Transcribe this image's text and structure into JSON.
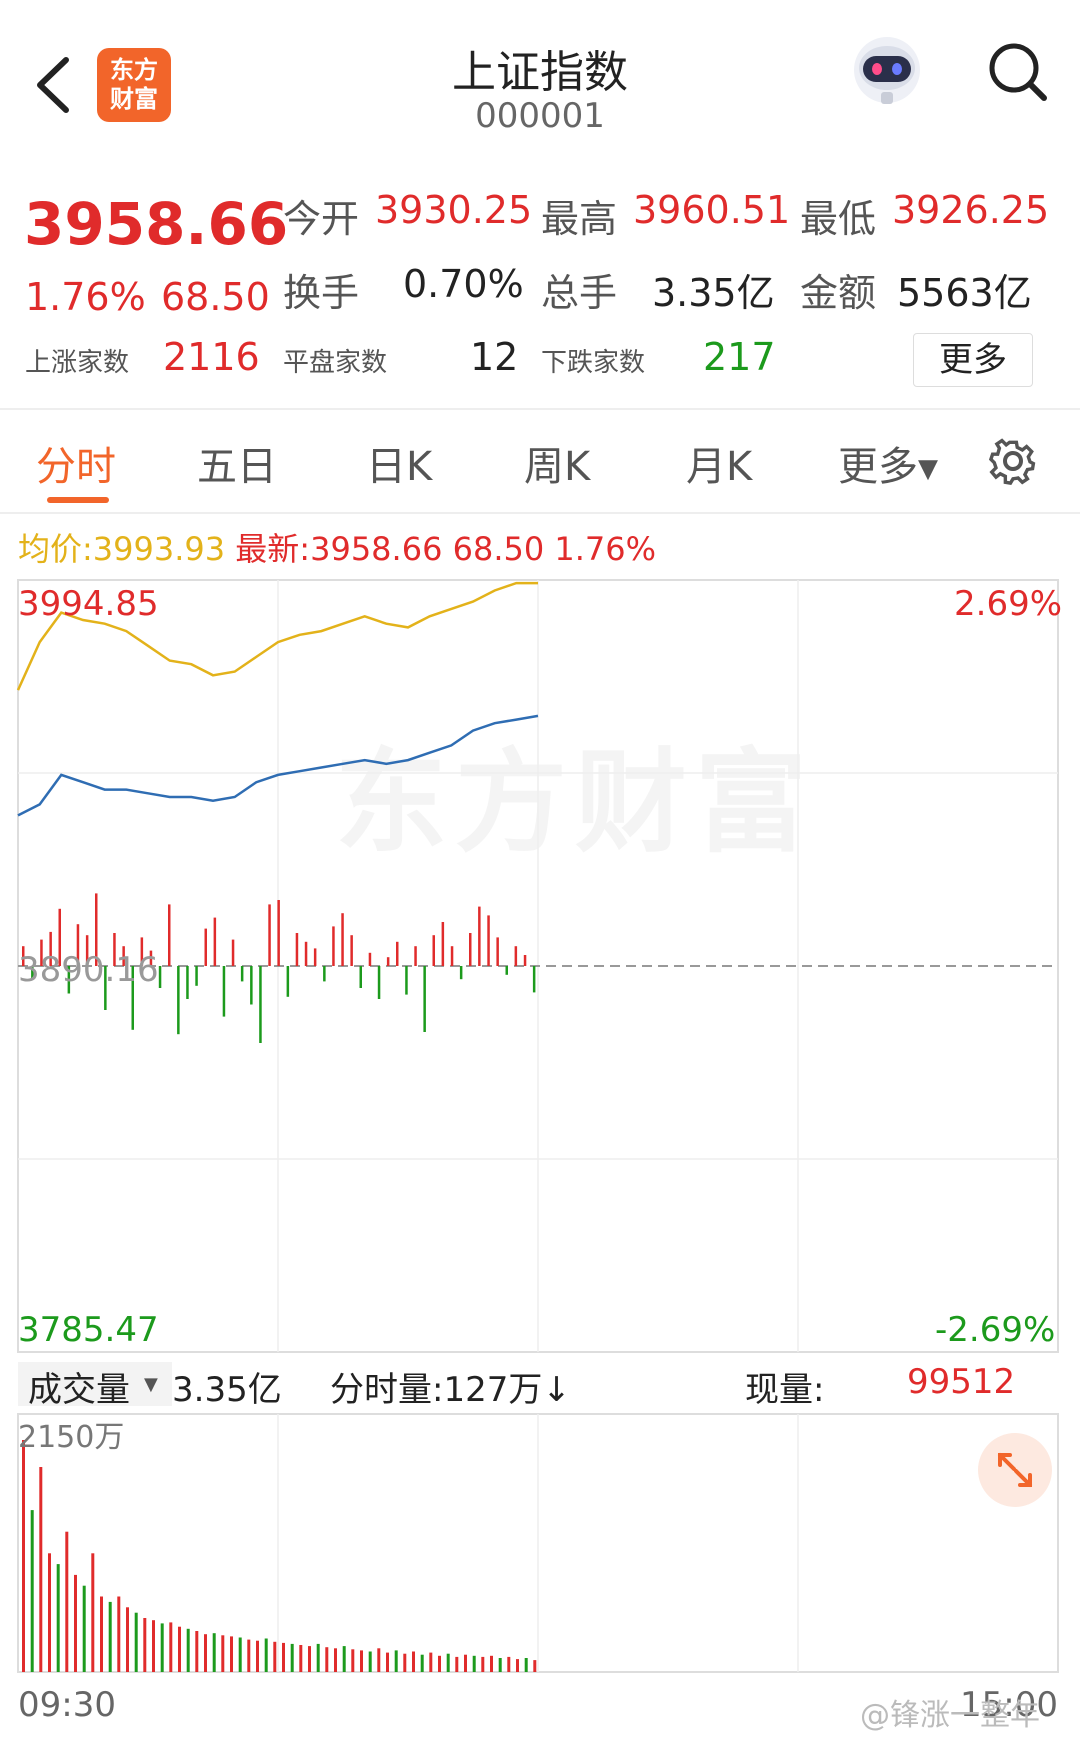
{
  "header": {
    "title": "上证指数",
    "code": "000001",
    "logo_text": [
      "东方",
      "财富"
    ]
  },
  "quote": {
    "price": "3958.66",
    "change_pct": "1.76%",
    "change": "68.50",
    "open_label": "今开",
    "open": "3930.25",
    "high_label": "最高",
    "high": "3960.51",
    "low_label": "最低",
    "low": "3926.25",
    "turnover_label": "换手",
    "turnover": "0.70%",
    "volume_label": "总手",
    "volume": "3.35亿",
    "amount_label": "金额",
    "amount": "5563亿",
    "up_label": "上涨家数",
    "up_count": "2116",
    "flat_label": "平盘家数",
    "flat_count": "12",
    "down_label": "下跌家数",
    "down_count": "217",
    "more_label": "更多"
  },
  "tabs": [
    "分时",
    "五日",
    "日K",
    "周K",
    "月K",
    "更多"
  ],
  "chart_header": {
    "avg_label": "均价:",
    "avg_value": "3993.93",
    "latest_label": "最新:",
    "latest_value": "3958.66 68.50 1.76%"
  },
  "axis": {
    "top_price": "3994.85",
    "top_pct": "2.69%",
    "mid_price": "3890.16",
    "bottom_price": "3785.47",
    "bottom_pct": "-2.69%",
    "time_start": "09:30",
    "time_end": "15:00"
  },
  "volume_bar": {
    "selector": "成交量",
    "total": "3.35亿",
    "tick_label": "分时量:",
    "tick_value": "127万",
    "tick_arrow": "↓",
    "now_label": "现量:",
    "now_value": "99512",
    "vol_max": "2150万"
  },
  "watermark": {
    "bg": "东方财富",
    "footer": "@锋涨一整年"
  },
  "colors": {
    "up": "#e02b2b",
    "down": "#1c9a1c",
    "avg_line": "#e3b21a",
    "price_line": "#2f6db3",
    "accent": "#f2652a"
  },
  "chart_data": {
    "type": "line",
    "x": [
      "09:30",
      "09:35",
      "09:40",
      "09:45",
      "09:50",
      "09:55",
      "10:00",
      "10:05",
      "10:10",
      "10:15",
      "10:20",
      "10:25",
      "10:30",
      "10:35",
      "10:40",
      "10:45",
      "10:50",
      "10:55",
      "11:00",
      "11:05",
      "11:10",
      "11:15",
      "11:20",
      "11:25",
      "11:30"
    ],
    "series": [
      {
        "values": [
          3965,
          3978,
          3986,
          3984,
          3983,
          3981,
          3977,
          3973,
          3972,
          3969,
          3970,
          3974,
          3978,
          3980,
          3981,
          3983,
          3985,
          3983,
          3982,
          3985,
          3987,
          3989,
          3992,
          3994,
          3994
        ]
      },
      {
        "values": [
          3931,
          3934,
          3942,
          3940,
          3938,
          3938,
          3937,
          3936,
          3936,
          3935,
          3936,
          3940,
          3942,
          3943,
          3944,
          3945,
          3946,
          3945,
          3946,
          3948,
          3950,
          3954,
          3956,
          3957,
          3958
        ]
      }
    ],
    "ylim": [
      3785.47,
      3994.85
    ],
    "xlim": [
      "09:30",
      "15:00"
    ],
    "reference_price": 3890.16,
    "up_down_bars": [
      18,
      -12,
      24,
      31,
      52,
      -25,
      38,
      28,
      66,
      -40,
      30,
      18,
      -58,
      26,
      14,
      -20,
      56,
      -62,
      -30,
      -18,
      34,
      44,
      -46,
      24,
      -14,
      -35,
      -70,
      56,
      60,
      -28,
      30,
      22,
      16,
      -14,
      36,
      48,
      28,
      -20,
      12,
      -30,
      8,
      22,
      -26,
      18,
      -60,
      28,
      40,
      18,
      -12,
      30,
      54,
      46,
      26,
      -8,
      18,
      10,
      -24
    ],
    "volume_bars": [
      2150,
      1500,
      1900,
      1100,
      1000,
      1300,
      900,
      800,
      1100,
      700,
      650,
      700,
      600,
      550,
      500,
      480,
      450,
      460,
      420,
      400,
      380,
      350,
      360,
      340,
      330,
      320,
      300,
      290,
      310,
      280,
      270,
      260,
      250,
      240,
      260,
      230,
      220,
      240,
      210,
      200,
      190,
      220,
      180,
      200,
      170,
      190,
      160,
      180,
      150,
      170,
      140,
      160,
      150,
      140,
      150,
      130,
      140,
      120,
      130,
      110
    ]
  }
}
